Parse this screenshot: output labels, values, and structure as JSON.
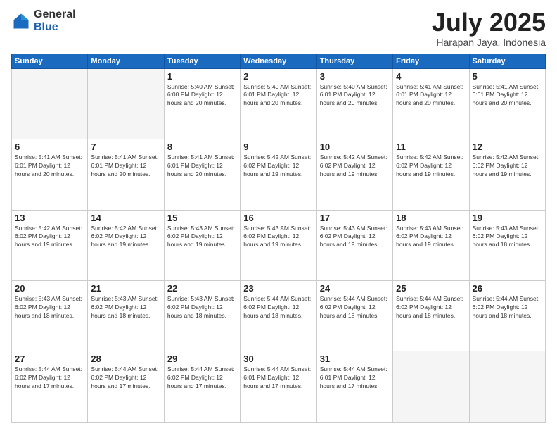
{
  "header": {
    "logo_general": "General",
    "logo_blue": "Blue",
    "month_year": "July 2025",
    "location": "Harapan Jaya, Indonesia"
  },
  "days_of_week": [
    "Sunday",
    "Monday",
    "Tuesday",
    "Wednesday",
    "Thursday",
    "Friday",
    "Saturday"
  ],
  "weeks": [
    [
      {
        "day": "",
        "info": ""
      },
      {
        "day": "",
        "info": ""
      },
      {
        "day": "1",
        "info": "Sunrise: 5:40 AM\nSunset: 6:00 PM\nDaylight: 12 hours and 20 minutes."
      },
      {
        "day": "2",
        "info": "Sunrise: 5:40 AM\nSunset: 6:01 PM\nDaylight: 12 hours and 20 minutes."
      },
      {
        "day": "3",
        "info": "Sunrise: 5:40 AM\nSunset: 6:01 PM\nDaylight: 12 hours and 20 minutes."
      },
      {
        "day": "4",
        "info": "Sunrise: 5:41 AM\nSunset: 6:01 PM\nDaylight: 12 hours and 20 minutes."
      },
      {
        "day": "5",
        "info": "Sunrise: 5:41 AM\nSunset: 6:01 PM\nDaylight: 12 hours and 20 minutes."
      }
    ],
    [
      {
        "day": "6",
        "info": "Sunrise: 5:41 AM\nSunset: 6:01 PM\nDaylight: 12 hours and 20 minutes."
      },
      {
        "day": "7",
        "info": "Sunrise: 5:41 AM\nSunset: 6:01 PM\nDaylight: 12 hours and 20 minutes."
      },
      {
        "day": "8",
        "info": "Sunrise: 5:41 AM\nSunset: 6:01 PM\nDaylight: 12 hours and 20 minutes."
      },
      {
        "day": "9",
        "info": "Sunrise: 5:42 AM\nSunset: 6:02 PM\nDaylight: 12 hours and 19 minutes."
      },
      {
        "day": "10",
        "info": "Sunrise: 5:42 AM\nSunset: 6:02 PM\nDaylight: 12 hours and 19 minutes."
      },
      {
        "day": "11",
        "info": "Sunrise: 5:42 AM\nSunset: 6:02 PM\nDaylight: 12 hours and 19 minutes."
      },
      {
        "day": "12",
        "info": "Sunrise: 5:42 AM\nSunset: 6:02 PM\nDaylight: 12 hours and 19 minutes."
      }
    ],
    [
      {
        "day": "13",
        "info": "Sunrise: 5:42 AM\nSunset: 6:02 PM\nDaylight: 12 hours and 19 minutes."
      },
      {
        "day": "14",
        "info": "Sunrise: 5:42 AM\nSunset: 6:02 PM\nDaylight: 12 hours and 19 minutes."
      },
      {
        "day": "15",
        "info": "Sunrise: 5:43 AM\nSunset: 6:02 PM\nDaylight: 12 hours and 19 minutes."
      },
      {
        "day": "16",
        "info": "Sunrise: 5:43 AM\nSunset: 6:02 PM\nDaylight: 12 hours and 19 minutes."
      },
      {
        "day": "17",
        "info": "Sunrise: 5:43 AM\nSunset: 6:02 PM\nDaylight: 12 hours and 19 minutes."
      },
      {
        "day": "18",
        "info": "Sunrise: 5:43 AM\nSunset: 6:02 PM\nDaylight: 12 hours and 19 minutes."
      },
      {
        "day": "19",
        "info": "Sunrise: 5:43 AM\nSunset: 6:02 PM\nDaylight: 12 hours and 18 minutes."
      }
    ],
    [
      {
        "day": "20",
        "info": "Sunrise: 5:43 AM\nSunset: 6:02 PM\nDaylight: 12 hours and 18 minutes."
      },
      {
        "day": "21",
        "info": "Sunrise: 5:43 AM\nSunset: 6:02 PM\nDaylight: 12 hours and 18 minutes."
      },
      {
        "day": "22",
        "info": "Sunrise: 5:43 AM\nSunset: 6:02 PM\nDaylight: 12 hours and 18 minutes."
      },
      {
        "day": "23",
        "info": "Sunrise: 5:44 AM\nSunset: 6:02 PM\nDaylight: 12 hours and 18 minutes."
      },
      {
        "day": "24",
        "info": "Sunrise: 5:44 AM\nSunset: 6:02 PM\nDaylight: 12 hours and 18 minutes."
      },
      {
        "day": "25",
        "info": "Sunrise: 5:44 AM\nSunset: 6:02 PM\nDaylight: 12 hours and 18 minutes."
      },
      {
        "day": "26",
        "info": "Sunrise: 5:44 AM\nSunset: 6:02 PM\nDaylight: 12 hours and 18 minutes."
      }
    ],
    [
      {
        "day": "27",
        "info": "Sunrise: 5:44 AM\nSunset: 6:02 PM\nDaylight: 12 hours and 17 minutes."
      },
      {
        "day": "28",
        "info": "Sunrise: 5:44 AM\nSunset: 6:02 PM\nDaylight: 12 hours and 17 minutes."
      },
      {
        "day": "29",
        "info": "Sunrise: 5:44 AM\nSunset: 6:02 PM\nDaylight: 12 hours and 17 minutes."
      },
      {
        "day": "30",
        "info": "Sunrise: 5:44 AM\nSunset: 6:01 PM\nDaylight: 12 hours and 17 minutes."
      },
      {
        "day": "31",
        "info": "Sunrise: 5:44 AM\nSunset: 6:01 PM\nDaylight: 12 hours and 17 minutes."
      },
      {
        "day": "",
        "info": ""
      },
      {
        "day": "",
        "info": ""
      }
    ]
  ]
}
